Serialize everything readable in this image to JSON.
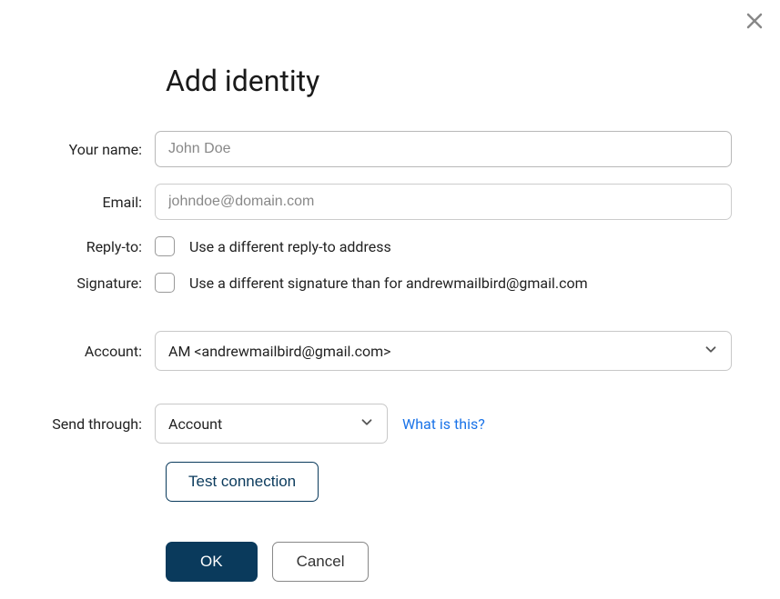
{
  "dialog": {
    "title": "Add identity"
  },
  "labels": {
    "name": "Your name:",
    "email": "Email:",
    "replyto": "Reply-to:",
    "signature": "Signature:",
    "account": "Account:",
    "sendthrough": "Send through:"
  },
  "fields": {
    "name_placeholder": "John Doe",
    "name_value": "",
    "email_placeholder": "johndoe@domain.com",
    "email_value": "",
    "replyto_text": "Use a different reply-to address",
    "signature_text": "Use a different signature than for andrewmailbird@gmail.com",
    "account_selected": "AM <andrewmailbird@gmail.com>",
    "sendthrough_selected": "Account"
  },
  "links": {
    "what_is_this": "What is this?"
  },
  "buttons": {
    "test_connection": "Test connection",
    "ok": "OK",
    "cancel": "Cancel"
  }
}
